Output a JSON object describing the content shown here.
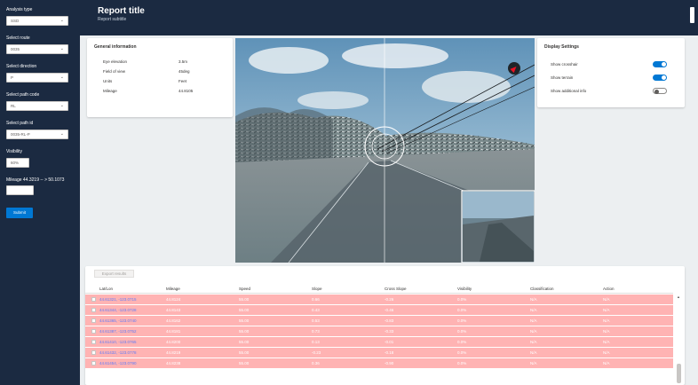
{
  "sidebar": {
    "analysis_type": {
      "label": "Analysis type",
      "value": "SSD"
    },
    "select_route": {
      "label": "Select route",
      "value": "0035"
    },
    "select_direction": {
      "label": "Select direction",
      "value": "P"
    },
    "select_path_code": {
      "label": "Select path code",
      "value": "RL"
    },
    "select_path_id": {
      "label": "Select path id",
      "value": "0035-RL-P"
    },
    "visibility": {
      "label": "Visibility",
      "value": "60%"
    },
    "mileage": {
      "label": "Mileage 44.3219 -- > 50.1073",
      "value": ""
    },
    "submit_label": "Submit"
  },
  "header": {
    "title": "Report title",
    "subtitle": "Report subtitle"
  },
  "general_info": {
    "title": "General information",
    "rows": [
      {
        "key": "Eye elevation",
        "value": "3.5m"
      },
      {
        "key": "Field of view",
        "value": "45deg"
      },
      {
        "key": "Units",
        "value": "Feet"
      },
      {
        "key": "Mileage",
        "value": "44.8105"
      }
    ]
  },
  "display_settings": {
    "title": "Display Settings",
    "toggles": [
      {
        "label": "Show crosshair",
        "on": true
      },
      {
        "label": "Show terrain",
        "on": true
      },
      {
        "label": "Show additional info",
        "on": false
      }
    ]
  },
  "table": {
    "toolbar_button": "Export results",
    "columns": [
      "Lat/Lon",
      "Mileage",
      "Speed",
      "Slope",
      "Cross Slope",
      "Visibility",
      "Classification",
      "Action"
    ],
    "rows": [
      {
        "latlon": "44.61321, -123.0715",
        "mileage": "44.8124",
        "speed": "55.00",
        "slope": "0.66",
        "cross_slope": "-0.26",
        "visibility": "0.0%",
        "classification": "N/A",
        "action": "N/A"
      },
      {
        "latlon": "44.61344, -123.0728",
        "mileage": "44.8143",
        "speed": "55.00",
        "slope": "0.43",
        "cross_slope": "-0.46",
        "visibility": "0.0%",
        "classification": "N/A",
        "action": "N/A"
      },
      {
        "latlon": "44.61365, -123.0740",
        "mileage": "44.8162",
        "speed": "55.00",
        "slope": "0.53",
        "cross_slope": "-0.83",
        "visibility": "0.0%",
        "classification": "N/A",
        "action": "N/A"
      },
      {
        "latlon": "44.61387, -123.0752",
        "mileage": "44.8181",
        "speed": "55.00",
        "slope": "0.73",
        "cross_slope": "-0.33",
        "visibility": "0.0%",
        "classification": "N/A",
        "action": "N/A"
      },
      {
        "latlon": "44.61410, -123.0765",
        "mileage": "44.8200",
        "speed": "55.00",
        "slope": "0.13",
        "cross_slope": "-0.01",
        "visibility": "0.0%",
        "classification": "N/A",
        "action": "N/A"
      },
      {
        "latlon": "44.61432, -123.0778",
        "mileage": "44.8219",
        "speed": "55.00",
        "slope": "-0.23",
        "cross_slope": "-0.18",
        "visibility": "0.0%",
        "classification": "N/A",
        "action": "N/A"
      },
      {
        "latlon": "44.61454, -123.0790",
        "mileage": "44.8238",
        "speed": "55.00",
        "slope": "0.36",
        "cross_slope": "-0.90",
        "visibility": "0.0%",
        "classification": "N/A",
        "action": "N/A"
      }
    ]
  },
  "colors": {
    "sidebar_bg": "#1b2a41",
    "accent": "#0078d4",
    "row_highlight": "#ffb3b3",
    "link": "#5c7cfa"
  }
}
